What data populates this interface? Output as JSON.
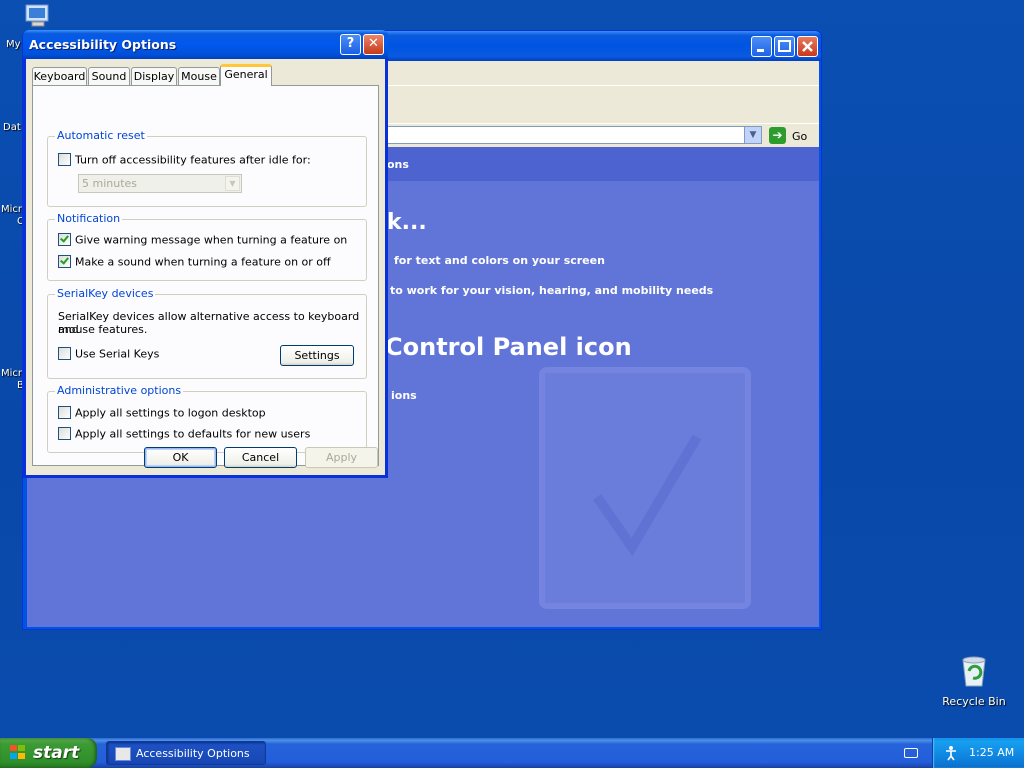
{
  "desktop": {
    "icon_labels": [
      "My",
      "Dat",
      "Micr",
      "C",
      "Micr",
      "B"
    ],
    "recycle_bin_label": "Recycle Bin"
  },
  "control_panel": {
    "address_go_label": "Go",
    "header_fragment": "ons",
    "heading_fragment": "k...",
    "task_1_fragment": "for text and colors on your screen",
    "task_2_fragment": "to work for your vision, hearing, and mobility needs",
    "heading_2_fragment": "Control Panel icon",
    "link_fragment": "ions"
  },
  "dialog": {
    "title": "Accessibility Options",
    "help_glyph": "?",
    "close_glyph": "✕",
    "tabs": [
      {
        "label": "Keyboard",
        "active": false
      },
      {
        "label": "Sound",
        "active": false
      },
      {
        "label": "Display",
        "active": false
      },
      {
        "label": "Mouse",
        "active": false
      },
      {
        "label": "General",
        "active": true
      }
    ],
    "automatic_reset": {
      "title": "Automatic reset",
      "checkbox_label": "Turn off accessibility features after idle for:",
      "checked": false,
      "idle_value": "5 minutes"
    },
    "notification": {
      "title": "Notification",
      "warning_label": "Give warning message when turning a feature on",
      "warning_checked": true,
      "sound_label": "Make a sound when turning a feature on or off",
      "sound_checked": true
    },
    "serialkey": {
      "title": "SerialKey devices",
      "description_line1": "SerialKey devices allow alternative access to keyboard and",
      "description_line2": "mouse features.",
      "checkbox_label": "Use Serial Keys",
      "checked": false,
      "settings_button": "Settings"
    },
    "administrative": {
      "title": "Administrative options",
      "logon_label": "Apply all settings to logon desktop",
      "logon_checked": false,
      "defaults_label": "Apply all settings to defaults for new users",
      "defaults_checked": false
    },
    "buttons": {
      "ok": "OK",
      "cancel": "Cancel",
      "apply": "Apply"
    }
  },
  "taskbar": {
    "start_label": "start",
    "task_item_label": "Accessibility Options",
    "clock": "1:25 AM"
  },
  "colors": {
    "desktop_blue": "#0b4fb3",
    "xp_title_blue": "#0054e3",
    "group_title_blue": "#0046d5",
    "start_green": "#3c9b34",
    "tab_highlight": "#ffc83c"
  }
}
